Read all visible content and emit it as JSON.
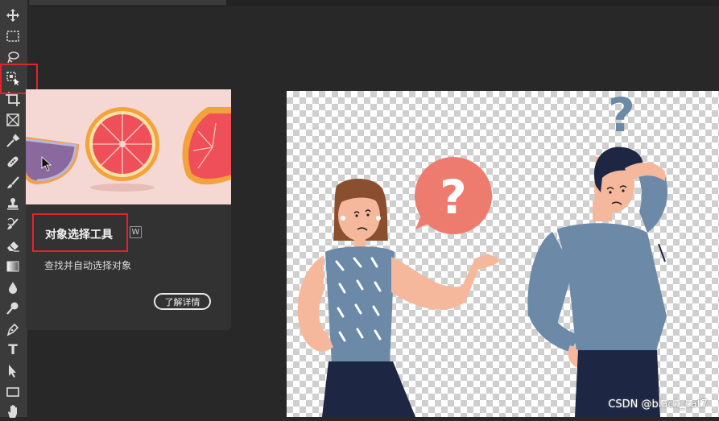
{
  "toolbar": {
    "tools": [
      {
        "icon": "move-icon"
      },
      {
        "icon": "rectangular-marquee-icon"
      },
      {
        "icon": "lasso-icon"
      },
      {
        "icon": "object-selection-icon"
      },
      {
        "icon": "crop-icon"
      },
      {
        "icon": "frame-icon"
      },
      {
        "icon": "eyedropper-icon"
      },
      {
        "icon": "healing-brush-icon"
      },
      {
        "icon": "brush-icon"
      },
      {
        "icon": "clone-stamp-icon"
      },
      {
        "icon": "history-brush-icon"
      },
      {
        "icon": "eraser-icon"
      },
      {
        "icon": "gradient-icon"
      },
      {
        "icon": "blur-icon"
      },
      {
        "icon": "dodge-icon"
      },
      {
        "icon": "pen-icon"
      },
      {
        "icon": "type-icon"
      },
      {
        "icon": "path-selection-icon"
      },
      {
        "icon": "rectangle-shape-icon"
      },
      {
        "icon": "hand-icon"
      }
    ],
    "type_tool_glyph": "T",
    "highlight_color": "#e0242e"
  },
  "tooltip": {
    "title": "对象选择工具",
    "shortcut": "W",
    "description": "查找并自动选择对象",
    "learn_more_label": "了解详情"
  },
  "canvas": {
    "speech_bubble_glyph": "?",
    "floating_glyph": "?"
  },
  "watermark": "CSDN @black_cat7"
}
